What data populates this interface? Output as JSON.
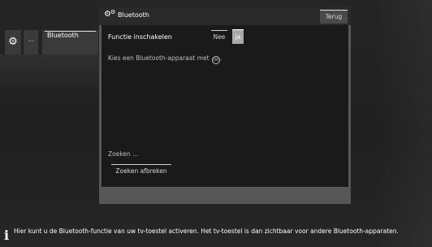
{
  "side_menu": {
    "settings_icon": "gear-icon",
    "more_label": "...",
    "selected_item": "Bluetooth"
  },
  "dialog": {
    "icon": "gears-icon",
    "title": "Bluetooth",
    "back_label": "Terug",
    "function_label": "Functie inschakelen",
    "options": [
      "Nee",
      "ja"
    ],
    "selected_option": "ja",
    "hint_text": "Kies een Bluetooth-apparaat met",
    "hint_icon": "ok-button-icon",
    "hint_icon_glyph": "OK",
    "hint_suffix": ".",
    "status_text": "Zoeken ...",
    "stop_search_label": "Zoeken afbreken"
  },
  "info_bar": {
    "icon": "info-icon",
    "text": "Hier kunt u de Bluetooth-functie van uw tv-toestel activeren. Het tv-toestel is dan zichtbaar voor andere Bluetooth-apparaten."
  },
  "colors": {
    "background": "#222222",
    "dialog_frame": "#575757",
    "dialog_header": "#2a2a2a",
    "dialog_body": "#1a1a1a",
    "selected_option": "#a9a9a9",
    "text": "#ffffff"
  }
}
